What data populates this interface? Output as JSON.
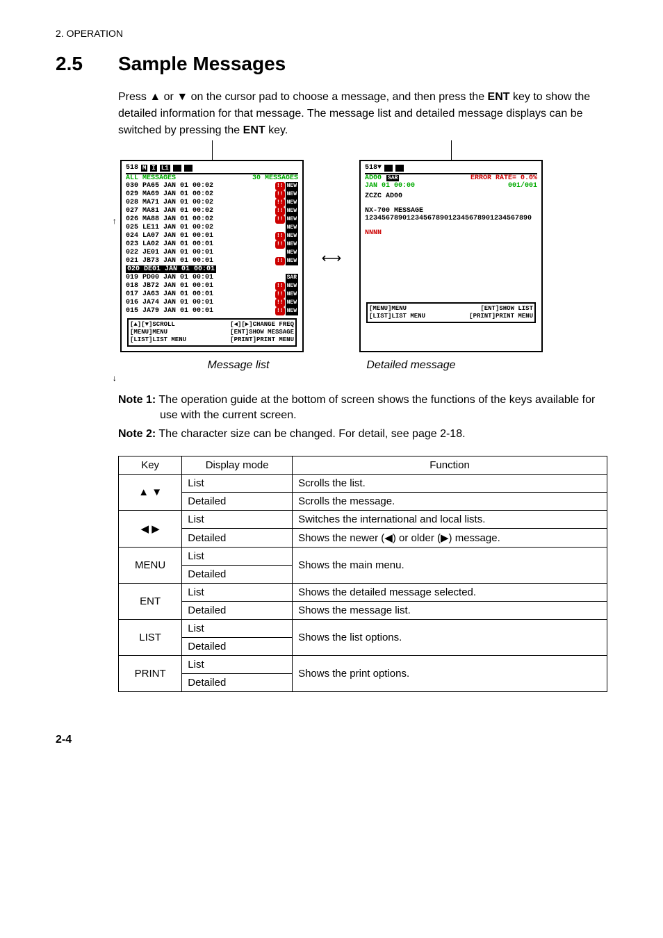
{
  "header": "2. OPERATION",
  "section_number": "2.5",
  "section_title": "Sample Messages",
  "intro_parts": {
    "t1": "Press ",
    "up": "▲",
    "t2": " or ",
    "down": "▼",
    "t3": " on the cursor pad to choose a message, and then press the ",
    "ent": "ENT",
    "t4": " key to show the detailed information for that message. The message list and detailed message displays can be switched by pressing the ",
    "ent2": "ENT",
    "t5": " key."
  },
  "list_screen": {
    "freq": "518",
    "icons": [
      "M",
      "I",
      "L1"
    ],
    "title": "ALL MESSAGES",
    "count": "30 MESSAGES",
    "rows": [
      {
        "n": "030",
        "id": "PA65",
        "date": "JAN 01",
        "time": "00:02",
        "alert": true,
        "new": true
      },
      {
        "n": "029",
        "id": "MA69",
        "date": "JAN 01",
        "time": "00:02",
        "alert": true,
        "new": true
      },
      {
        "n": "028",
        "id": "MA71",
        "date": "JAN 01",
        "time": "00:02",
        "alert": true,
        "new": true
      },
      {
        "n": "027",
        "id": "MA81",
        "date": "JAN 01",
        "time": "00:02",
        "alert": true,
        "new": true
      },
      {
        "n": "026",
        "id": "MA88",
        "date": "JAN 01",
        "time": "00:02",
        "alert": true,
        "new": true
      },
      {
        "n": "025",
        "id": "LE11",
        "date": "JAN 01",
        "time": "00:02",
        "alert": false,
        "new": true
      },
      {
        "n": "024",
        "id": "LA07",
        "date": "JAN 01",
        "time": "00:01",
        "alert": true,
        "new": true
      },
      {
        "n": "023",
        "id": "LA02",
        "date": "JAN 01",
        "time": "00:01",
        "alert": true,
        "new": true
      },
      {
        "n": "022",
        "id": "JE01",
        "date": "JAN 01",
        "time": "00:01",
        "alert": false,
        "new": true
      },
      {
        "n": "021",
        "id": "JB73",
        "date": "JAN 01",
        "time": "00:01",
        "alert": true,
        "new": true
      },
      {
        "n": "020",
        "id": "DE01",
        "date": "JAN 01",
        "time": "00:01",
        "selected": true
      },
      {
        "n": "019",
        "id": "PD00",
        "date": "JAN 01",
        "time": "00:01",
        "sar": true
      },
      {
        "n": "018",
        "id": "JB72",
        "date": "JAN 01",
        "time": "00:01",
        "alert": true,
        "new": true
      },
      {
        "n": "017",
        "id": "JA63",
        "date": "JAN 01",
        "time": "00:01",
        "alert": true,
        "new": true
      },
      {
        "n": "016",
        "id": "JA74",
        "date": "JAN 01",
        "time": "00:01",
        "alert": true,
        "new": true
      },
      {
        "n": "015",
        "id": "JA79",
        "date": "JAN 01",
        "time": "00:01",
        "alert": true,
        "new": true
      }
    ],
    "guide": {
      "r1l": "[▲][▼]SCROLL",
      "r1r": "[◀][▶]CHANGE FREQ",
      "r2l": "[MENU]MENU",
      "r2r": "[ENT]SHOW MESSAGE",
      "r3l": "[LIST]LIST MENU",
      "r3r": "[PRINT]PRINT MENU"
    }
  },
  "detail_screen": {
    "freq": "518▼",
    "id": "AD00",
    "sar": "SAR",
    "error": "ERROR RATE= 0.0%",
    "date": "JAN 01 00:00",
    "page": "001/001",
    "body1": "ZCZC AD00",
    "body2": "NX-700      MESSAGE",
    "body3": "1234567890123456789012345678901234567890",
    "body4": "NNNN",
    "guide": {
      "r1l": "[MENU]MENU",
      "r1r": "[ENT]SHOW LIST",
      "r2l": "[LIST]LIST MENU",
      "r2r": "[PRINT]PRINT MENU"
    }
  },
  "captions": {
    "left": "Message list",
    "right": "Detailed message"
  },
  "notes": {
    "n1_label": "Note 1:",
    "n1": " The operation guide at the bottom of screen shows the functions of the keys available for use with the current screen.",
    "n2_label": "Note 2:",
    "n2": " The character size can be changed. For detail, see page 2-18."
  },
  "table": {
    "headers": {
      "key": "Key",
      "mode": "Display mode",
      "func": "Function"
    },
    "rows": [
      {
        "key": "▲ ▼",
        "mode": "List",
        "func": "Scrolls the list."
      },
      {
        "key": "",
        "mode": "Detailed",
        "func": "Scrolls the message."
      },
      {
        "key": "◀ ▶",
        "mode": "List",
        "func": "Switches the international and local lists."
      },
      {
        "key": "",
        "mode": "Detailed",
        "func": "Shows the newer (◀) or older (▶) message."
      },
      {
        "key": "MENU",
        "mode": "List",
        "func_rowspan": "Shows the main menu."
      },
      {
        "key": "",
        "mode": "Detailed",
        "func": ""
      },
      {
        "key": "ENT",
        "mode": "List",
        "func": "Shows the detailed message selected."
      },
      {
        "key": "",
        "mode": "Detailed",
        "func": "Shows the message list."
      },
      {
        "key": "LIST",
        "mode": "List",
        "func_rowspan": "Shows the list options."
      },
      {
        "key": "",
        "mode": "Detailed",
        "func": ""
      },
      {
        "key": "PRINT",
        "mode": "List",
        "func_rowspan": "Shows the print options."
      },
      {
        "key": "",
        "mode": "Detailed",
        "func": ""
      }
    ]
  },
  "page_number": "2-4",
  "badges": {
    "alert": "!!",
    "new": "NEW",
    "sar": "SAR"
  }
}
